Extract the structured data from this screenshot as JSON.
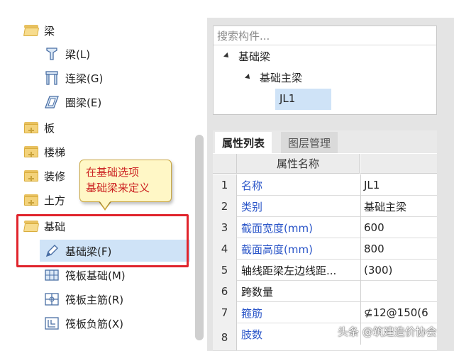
{
  "tree": {
    "items": [
      {
        "label": "梁",
        "kind": "folder-open",
        "icon": "folder-open-icon"
      },
      {
        "label": "梁(L)",
        "kind": "child",
        "icon": "beam-icon"
      },
      {
        "label": "连梁(G)",
        "kind": "child",
        "icon": "coupling-beam-icon"
      },
      {
        "label": "圈梁(E)",
        "kind": "child",
        "icon": "ring-beam-icon"
      },
      {
        "label": "板",
        "kind": "folder",
        "icon": "folder-icon"
      },
      {
        "label": "楼梯",
        "kind": "folder",
        "icon": "folder-icon"
      },
      {
        "label": "装修",
        "kind": "folder",
        "icon": "folder-icon"
      },
      {
        "label": "土方",
        "kind": "folder",
        "icon": "folder-icon"
      },
      {
        "label": "基础",
        "kind": "folder-open",
        "icon": "folder-open-icon"
      },
      {
        "label": "基础梁(F)",
        "kind": "child",
        "icon": "pencil-icon",
        "selected": true
      },
      {
        "label": "筏板基础(M)",
        "kind": "child",
        "icon": "raft-foundation-icon"
      },
      {
        "label": "筏板主筋(R)",
        "kind": "child",
        "icon": "raft-main-rebar-icon"
      },
      {
        "label": "筏板负筋(X)",
        "kind": "child",
        "icon": "raft-negative-rebar-icon"
      }
    ]
  },
  "callout": {
    "line1": "在基础选项",
    "line2": "基础梁来定义"
  },
  "component_tree": {
    "search_placeholder": "搜索构件...",
    "root": "基础梁",
    "child": "基础主梁",
    "leaf": "JL1"
  },
  "tabs": {
    "properties": "属性列表",
    "layers": "图层管理"
  },
  "grid": {
    "header_name": "属性名称",
    "rows": [
      {
        "num": "1",
        "name": "名称",
        "value": "JL1",
        "blue": true
      },
      {
        "num": "2",
        "name": "类别",
        "value": "基础主梁",
        "blue": true
      },
      {
        "num": "3",
        "name": "截面宽度(mm)",
        "value": "600",
        "blue": true
      },
      {
        "num": "4",
        "name": "截面高度(mm)",
        "value": "800",
        "blue": true
      },
      {
        "num": "5",
        "name": "轴线距梁左边线距...",
        "value": "(300)",
        "blue": false
      },
      {
        "num": "6",
        "name": "跨数量",
        "value": "",
        "blue": false
      },
      {
        "num": "7",
        "name": "箍筋",
        "value": "⊈12@150(6",
        "blue": true
      },
      {
        "num": "8",
        "name": "肢数",
        "value": "",
        "blue": true
      }
    ]
  },
  "watermark": "头条 @筑建造价协会",
  "colors": {
    "highlight": "#cfe3f7",
    "red_box": "#e0242c",
    "blue_text": "#2a55c8",
    "callout_text": "#cc2222",
    "callout_bg": "#fff7c6"
  }
}
